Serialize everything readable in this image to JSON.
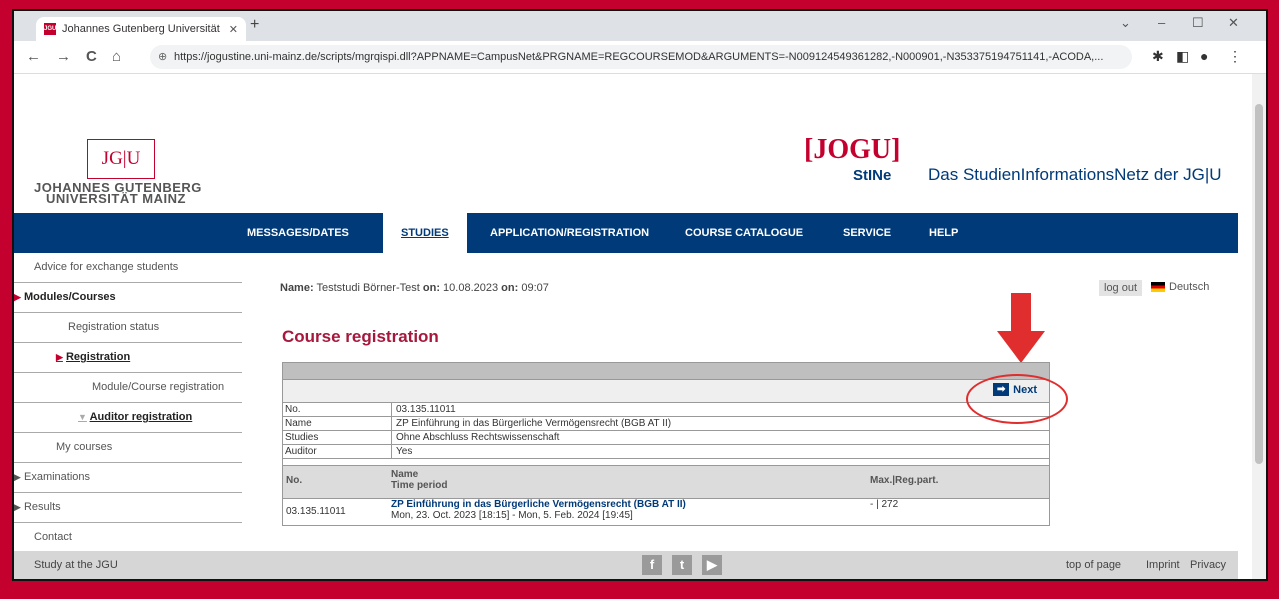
{
  "browser": {
    "tab_title": "Johannes Gutenberg Universität",
    "favicon_text": "JGU",
    "tab_close": "✕",
    "new_tab": "+",
    "url": "https://jogustine.uni-mainz.de/scripts/mgrqispi.dll?APPNAME=CampusNet&PRGNAME=REGCOURSEMOD&ARGUMENTS=-N009124549361282,-N000901,-N353375194751141,-ACODA,...",
    "nav": {
      "back": "←",
      "forward": "→",
      "reload": "C",
      "home": "⌂"
    },
    "window_controls": {
      "collapse": "⌄",
      "minimize": "–",
      "maximize": "☐",
      "close": "✕"
    }
  },
  "header": {
    "logo_mark": "JG|U",
    "logo_line1": "JOHANNES GUTENBERG",
    "logo_line2": "UNIVERSITÄT MAINZ",
    "jogu": "[JOGU]",
    "stine": "StINe",
    "tagline": "Das StudienInformationsNetz der JG|U"
  },
  "nav": {
    "items": [
      "MESSAGES/DATES",
      "STUDIES",
      "APPLICATION/REGISTRATION",
      "COURSE CATALOGUE",
      "SERVICE",
      "HELP"
    ],
    "active": "STUDIES"
  },
  "sidebar": {
    "items": [
      "Advice for exchange students",
      "Modules/Courses",
      "Registration status",
      "Registration",
      "Module/Course registration",
      "Auditor registration",
      "My courses",
      "Examinations",
      "Results",
      "Contact"
    ]
  },
  "main": {
    "name_label": "Name:",
    "name_value": "Teststudi Börner-Test",
    "on1_label": "on:",
    "on1_value": "10.08.2023",
    "on2_label": "on:",
    "on2_value": "09:07",
    "logout": "log out",
    "language": "Deutsch",
    "title": "Course registration",
    "next": "Next",
    "details": [
      {
        "key": "No.",
        "value": "03.135.11011"
      },
      {
        "key": "Name",
        "value": "ZP Einführung in das Bürgerliche Vermögensrecht (BGB AT II)"
      },
      {
        "key": "Studies",
        "value": "Ohne Abschluss Rechtswissenschaft"
      },
      {
        "key": "Auditor",
        "value": "Yes"
      }
    ],
    "courses_header": {
      "no": "No.",
      "name": "Name",
      "period": "Time period",
      "max": "Max.|Reg.part."
    },
    "course": {
      "no": "03.135.11011",
      "name": "ZP Einführung in das Bürgerliche Vermögensrecht (BGB AT II)",
      "period": "Mon, 23. Oct. 2023 [18:15] - Mon, 5. Feb. 2024 [19:45]",
      "max": "- | 272"
    }
  },
  "footer": {
    "left": "Study at the JGU",
    "top_of_page": "top of page",
    "imprint": "Imprint",
    "privacy": "Privacy"
  },
  "colors": {
    "brand_red": "#c4002f",
    "nav_blue": "#003a78",
    "title_red": "#a6193c"
  }
}
